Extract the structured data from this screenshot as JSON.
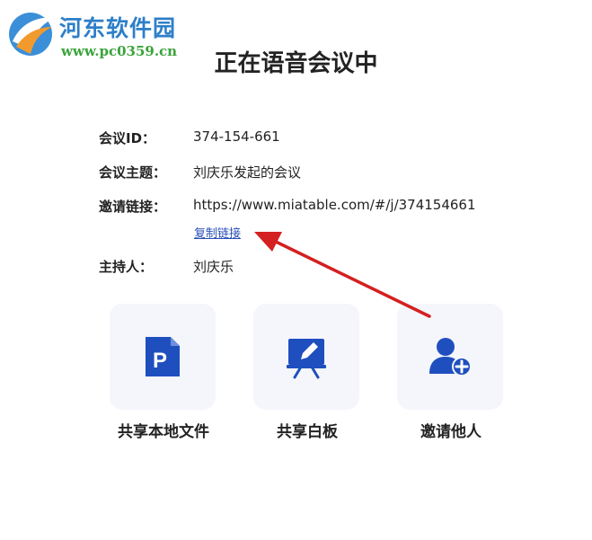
{
  "watermark": {
    "title": "河东软件园",
    "url": "www.pc0359.cn"
  },
  "page": {
    "title": "正在语音会议中"
  },
  "info": {
    "meeting_id": {
      "label": "会议ID：",
      "value": "374-154-661"
    },
    "topic": {
      "label": "会议主题：",
      "value": "刘庆乐发起的会议"
    },
    "invite_link": {
      "label": "邀请链接：",
      "value": "https://www.miatable.com/#/j/374154661",
      "copy_label": "复制链接"
    },
    "host": {
      "label": "主持人：",
      "value": "刘庆乐"
    }
  },
  "actions": [
    {
      "label": "共享本地文件",
      "icon": "ppt-file-icon"
    },
    {
      "label": "共享白板",
      "icon": "whiteboard-icon"
    },
    {
      "label": "邀请他人",
      "icon": "add-user-icon"
    }
  ],
  "colors": {
    "accent": "#1f4fbf",
    "tile_bg": "#f4f6fb",
    "arrow": "#d42020",
    "link": "#2a4fb8"
  }
}
